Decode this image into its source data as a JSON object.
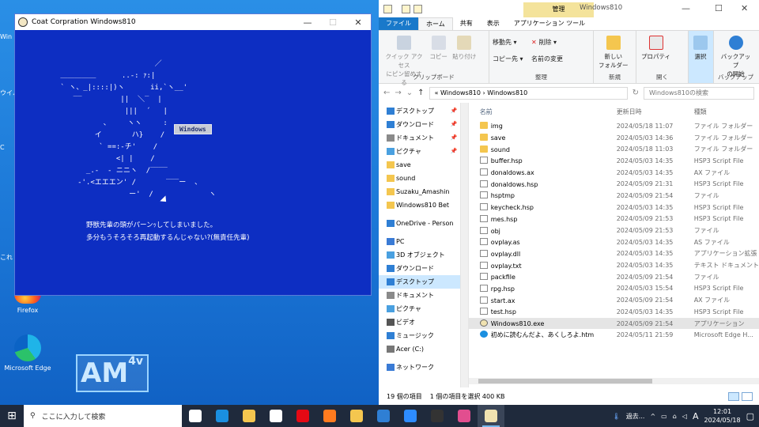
{
  "desktop": {
    "icons": [
      {
        "label": "Firefox"
      },
      {
        "label": "Microsoft Edge"
      }
    ],
    "logo_text": "AM",
    "logo_sup": "4v",
    "edge_labels": [
      "Win",
      "ウイル",
      "C",
      "これ"
    ]
  },
  "game": {
    "title": "Coat Corpration Windows810",
    "controls": {
      "minimize": "—",
      "maximize": "☐",
      "close": "✕"
    },
    "ascii_art": "                       ／\n ＿＿＿＿＿      ..-: ｧ:|\n ` ヽ、_|::::|)ヽ      ii,`ヽ__'\n    ‾‾         ||  ＼‾  |\n                |||  ´   |\n           、    ヽヽ     :\n         イ       ハ}    /\n          ` ==:-チ'    /\n              <| |    /\n       _.-  ‐ ニニヽ  /‾‾‾‾\n     ‐'.<エエエン' /       ‾‾‾ー  、\n                 ー'  /             ヽ",
    "windows_label": "Windows",
    "message_line1": "野獣先輩の頭がパーンｯしてしまいました。",
    "message_line2": "多分もうそろそろ再起動するんじゃない?(無責任先輩)"
  },
  "explorer": {
    "quick_access_title": "Windows810",
    "manage_tab": "管理",
    "tabs": [
      "ファイル",
      "ホーム",
      "共有",
      "表示",
      "アプリケーション ツール"
    ],
    "ribbon": {
      "clipboard": {
        "label": "クリップボード",
        "pin": "クイック アクセス\nにピン留めする",
        "copy": "コピー",
        "paste": "貼り付け"
      },
      "organize": {
        "label": "整理",
        "move": "移動先 ▾",
        "delete": "削除 ▾",
        "copyto": "コピー先 ▾",
        "rename": "名前の変更"
      },
      "new": {
        "label": "新規",
        "folder": "新しい\nフォルダー"
      },
      "open": {
        "label": "開く",
        "props": "プロパティ"
      },
      "select": {
        "label": "",
        "select": "選択"
      },
      "backup": {
        "label": "バックアップ",
        "start": "バックアップ\nの開始"
      }
    },
    "address": {
      "path": "« Windows810 › Windows810",
      "search_placeholder": "Windows810の検索"
    },
    "nav": [
      {
        "label": "デスクトップ",
        "pin": true,
        "color": "#2f7fd4"
      },
      {
        "label": "ダウンロード",
        "pin": true,
        "color": "#2f7fd4"
      },
      {
        "label": "ドキュメント",
        "pin": true,
        "color": "#8a8a8a"
      },
      {
        "label": "ピクチャ",
        "pin": true,
        "color": "#4aa0e0"
      },
      {
        "label": "save",
        "pin": false,
        "color": "#f4c64f"
      },
      {
        "label": "sound",
        "pin": false,
        "color": "#f4c64f"
      },
      {
        "label": "Suzaku_Amashin",
        "pin": false,
        "color": "#f4c64f"
      },
      {
        "label": "Windows810 Bet",
        "pin": false,
        "color": "#f4c64f"
      },
      {
        "label": "OneDrive - Person",
        "pin": false,
        "color": "#2f7fd4",
        "space": true
      },
      {
        "label": "PC",
        "pin": false,
        "color": "#3a7bd5",
        "space": true
      },
      {
        "label": "3D オブジェクト",
        "pin": false,
        "color": "#4aa0e0"
      },
      {
        "label": "ダウンロード",
        "pin": false,
        "color": "#2f7fd4"
      },
      {
        "label": "デスクトップ",
        "pin": false,
        "color": "#2f7fd4",
        "selected": true
      },
      {
        "label": "ドキュメント",
        "pin": false,
        "color": "#8a8a8a"
      },
      {
        "label": "ピクチャ",
        "pin": false,
        "color": "#4aa0e0"
      },
      {
        "label": "ビデオ",
        "pin": false,
        "color": "#555"
      },
      {
        "label": "ミュージック",
        "pin": false,
        "color": "#2f7fd4"
      },
      {
        "label": "Acer (C:)",
        "pin": false,
        "color": "#777"
      },
      {
        "label": "ネットワーク",
        "pin": false,
        "color": "#3a7bd5",
        "space": true
      }
    ],
    "columns": {
      "name": "名前",
      "date": "更新日時",
      "type": "種類"
    },
    "files": [
      {
        "name": "img",
        "date": "2024/05/18 11:07",
        "type": "ファイル フォルダー",
        "icon": "folder"
      },
      {
        "name": "save",
        "date": "2024/05/03 14:36",
        "type": "ファイル フォルダー",
        "icon": "folder"
      },
      {
        "name": "sound",
        "date": "2024/05/18 11:03",
        "type": "ファイル フォルダー",
        "icon": "folder"
      },
      {
        "name": "buffer.hsp",
        "date": "2024/05/03 14:35",
        "type": "HSP3 Script File",
        "icon": "doc"
      },
      {
        "name": "donaldows.ax",
        "date": "2024/05/03 14:35",
        "type": "AX ファイル",
        "icon": "doc"
      },
      {
        "name": "donaldows.hsp",
        "date": "2024/05/09 21:31",
        "type": "HSP3 Script File",
        "icon": "doc"
      },
      {
        "name": "hsptmp",
        "date": "2024/05/09 21:54",
        "type": "ファイル",
        "icon": "doc"
      },
      {
        "name": "keycheck.hsp",
        "date": "2024/05/03 14:35",
        "type": "HSP3 Script File",
        "icon": "doc"
      },
      {
        "name": "mes.hsp",
        "date": "2024/05/09 21:53",
        "type": "HSP3 Script File",
        "icon": "doc"
      },
      {
        "name": "obj",
        "date": "2024/05/09 21:53",
        "type": "ファイル",
        "icon": "doc"
      },
      {
        "name": "ovplay.as",
        "date": "2024/05/03 14:35",
        "type": "AS ファイル",
        "icon": "doc"
      },
      {
        "name": "ovplay.dll",
        "date": "2024/05/03 14:35",
        "type": "アプリケーション拡張",
        "icon": "doc"
      },
      {
        "name": "ovplay.txt",
        "date": "2024/05/03 14:35",
        "type": "テキスト ドキュメント",
        "icon": "doc"
      },
      {
        "name": "packfile",
        "date": "2024/05/09 21:54",
        "type": "ファイル",
        "icon": "doc"
      },
      {
        "name": "rpg.hsp",
        "date": "2024/05/03 15:54",
        "type": "HSP3 Script File",
        "icon": "doc"
      },
      {
        "name": "start.ax",
        "date": "2024/05/09 21:54",
        "type": "AX ファイル",
        "icon": "doc"
      },
      {
        "name": "test.hsp",
        "date": "2024/05/03 14:35",
        "type": "HSP3 Script File",
        "icon": "doc"
      },
      {
        "name": "Windows810.exe",
        "date": "2024/05/09 21:54",
        "type": "アプリケーション",
        "icon": "exe",
        "selected": true
      },
      {
        "name": "初めに読むんだよ、あくしろよ.htm",
        "date": "2024/05/11 21:59",
        "type": "Microsoft Edge H...",
        "icon": "edge"
      }
    ],
    "status": {
      "count": "19 個の項目",
      "selected": "1 個の項目を選択  400 KB"
    }
  },
  "taskbar": {
    "search_placeholder": "ここに入力して検索",
    "apps": [
      {
        "name": "task-view",
        "color": "#ffffff"
      },
      {
        "name": "edge",
        "color": "#1a8fe0"
      },
      {
        "name": "store",
        "color": "#f4c64f"
      },
      {
        "name": "amazon",
        "color": "#ffffff"
      },
      {
        "name": "netflix",
        "color": "#e50914"
      },
      {
        "name": "firefox",
        "color": "#ff7b1f"
      },
      {
        "name": "explorer",
        "color": "#f4c64f"
      },
      {
        "name": "mail",
        "color": "#2f7fd4"
      },
      {
        "name": "zoom",
        "color": "#2d8cff"
      },
      {
        "name": "ugh-app",
        "color": "#333333"
      },
      {
        "name": "pink-app",
        "color": "#e24e8f"
      },
      {
        "name": "windows810",
        "color": "#f0e2b0",
        "active": true
      }
    ],
    "weather": "過去...",
    "ime": "A",
    "time": "12:01",
    "date": "2024/05/18"
  }
}
